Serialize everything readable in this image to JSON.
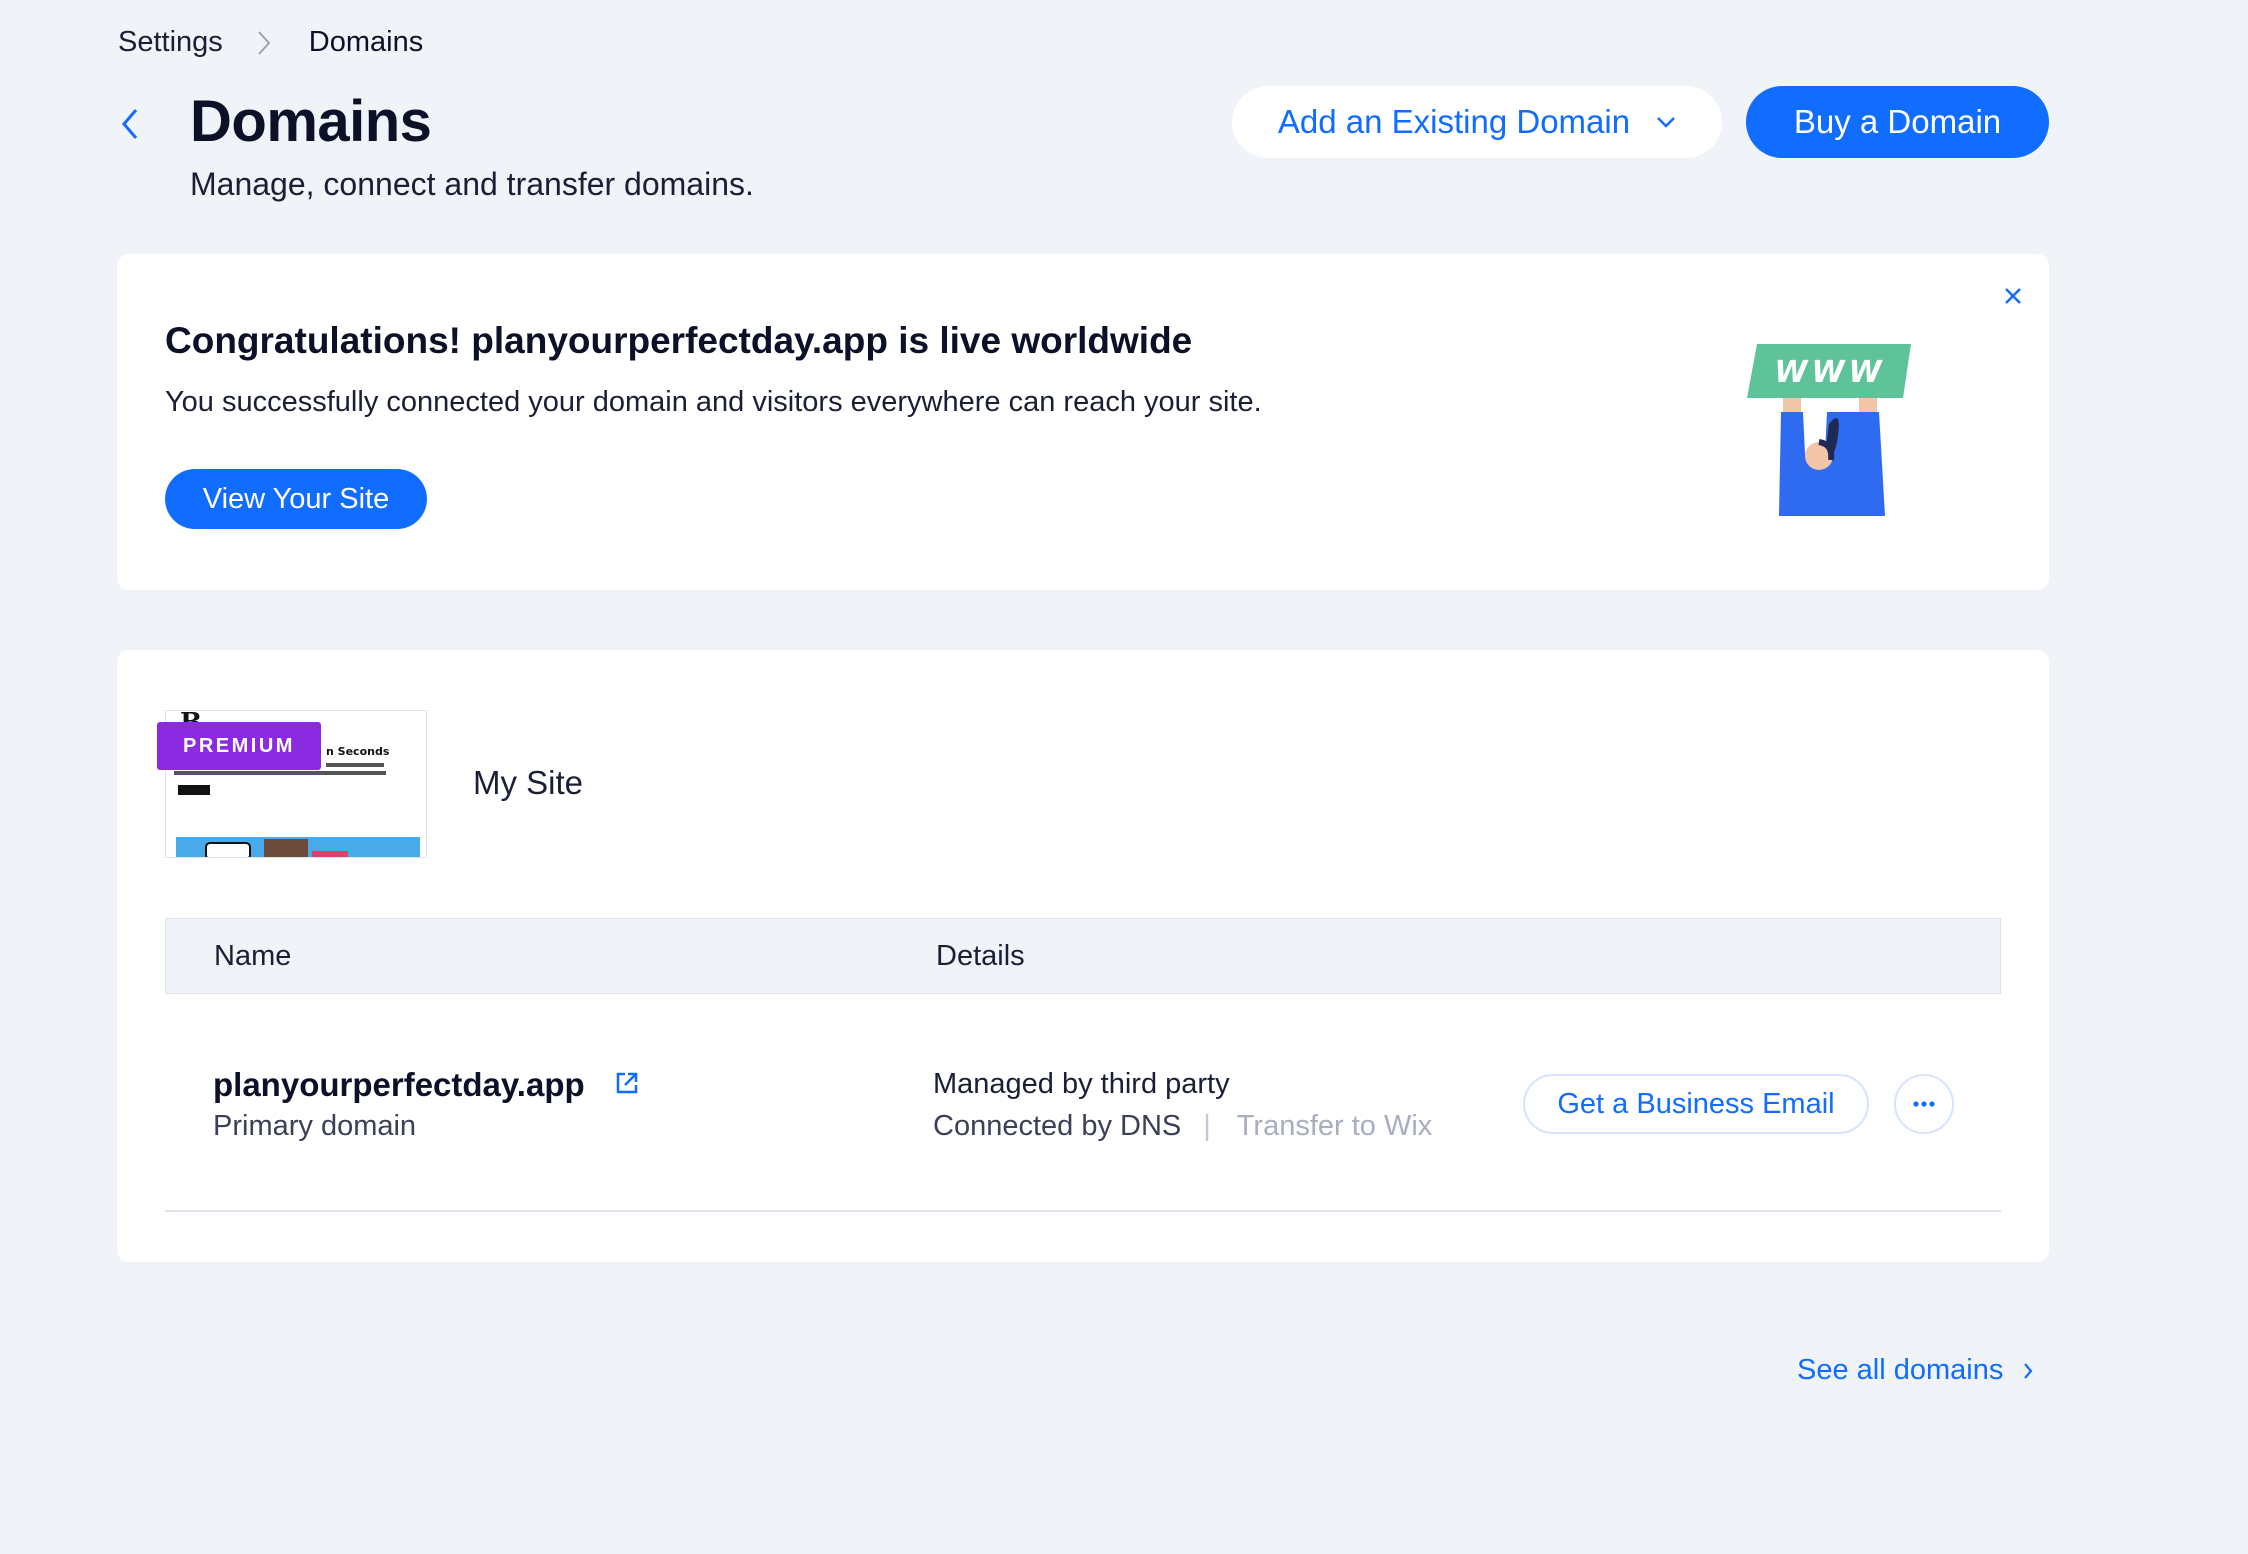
{
  "breadcrumb": {
    "parent": "Settings",
    "current": "Domains"
  },
  "header": {
    "title": "Domains",
    "subtitle": "Manage, connect and transfer domains.",
    "add_existing_label": "Add an Existing Domain",
    "buy_label": "Buy a Domain"
  },
  "banner": {
    "title": "Congratulations! planyourperfectday.app is live worldwide",
    "text": "You successfully connected your domain and visitors everywhere can reach your site.",
    "button_label": "View Your Site",
    "illustration_text": "WWW"
  },
  "site": {
    "badge": "PREMIUM",
    "name": "My Site",
    "thumb_text": "n Seconds"
  },
  "table": {
    "columns": [
      "Name",
      "Details"
    ],
    "rows": [
      {
        "domain": "planyourperfectday.app",
        "type": "Primary domain",
        "managed": "Managed by third party",
        "connection": "Connected by DNS",
        "transfer": "Transfer to Wix",
        "email_button": "Get a Business Email"
      }
    ]
  },
  "footer": {
    "see_all": "See all domains"
  },
  "colors": {
    "accent": "#116dff",
    "premium": "#8a2be2",
    "background": "#f0f3f7",
    "www_sign": "#5fc39a"
  },
  "icons": [
    "chevron-right-icon",
    "back-arrow-icon",
    "chevron-down-icon",
    "close-icon",
    "external-link-icon",
    "more-dots-icon"
  ]
}
